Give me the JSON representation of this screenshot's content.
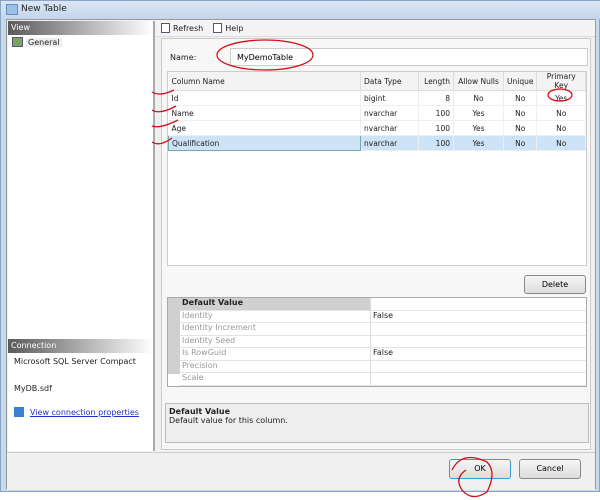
{
  "window": {
    "title": "New Table"
  },
  "left": {
    "view_header": "View",
    "general": "General",
    "connection_header": "Connection",
    "provider": "Microsoft SQL Server Compact",
    "database": "MyDB.sdf",
    "link": "View connection properties"
  },
  "toolbar": {
    "refresh": "Refresh",
    "help": "Help"
  },
  "name": {
    "label": "Name:",
    "value": "MyDemoTable"
  },
  "grid": {
    "headers": [
      "Column Name",
      "Data Type",
      "Length",
      "Allow Nulls",
      "Unique",
      "Primary Key"
    ],
    "rows": [
      [
        "Id",
        "bigint",
        "8",
        "No",
        "No",
        "Yes"
      ],
      [
        "Name",
        "nvarchar",
        "100",
        "Yes",
        "No",
        "No"
      ],
      [
        "Age",
        "nvarchar",
        "100",
        "Yes",
        "No",
        "No"
      ],
      [
        "Qualification",
        "nvarchar",
        "100",
        "Yes",
        "No",
        "No"
      ]
    ]
  },
  "delete": "Delete",
  "props": {
    "category": "Default Value",
    "rows": [
      [
        "Identity",
        "False"
      ],
      [
        "Identity Increment",
        ""
      ],
      [
        "Identity Seed",
        ""
      ],
      [
        "Is RowGuid",
        "False"
      ],
      [
        "Precision",
        ""
      ],
      [
        "Scale",
        ""
      ]
    ]
  },
  "desc": {
    "title": "Default Value",
    "text": "Default value for this column."
  },
  "buttons": {
    "ok": "OK",
    "cancel": "Cancel"
  },
  "colors": {
    "selection": "#cde3f7",
    "annotation": "#d0101a"
  }
}
